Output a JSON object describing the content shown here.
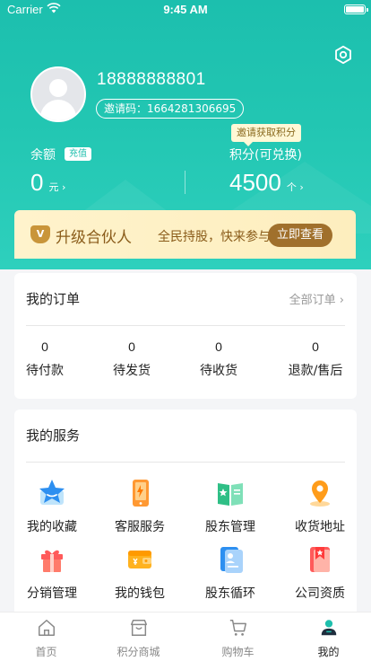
{
  "status_bar": {
    "carrier": "Carrier",
    "time": "9:45 AM"
  },
  "profile": {
    "phone": "18888888801",
    "invite_code_label": "邀请码：1664281306695"
  },
  "balance": {
    "label": "余额",
    "recharge_label": "充值",
    "value": "0",
    "unit": "元 ›"
  },
  "points": {
    "tag": "邀请获取积分",
    "label": "积分(可兑换)",
    "value": "4500",
    "unit": "个 ›"
  },
  "partner_banner": {
    "icon": "V",
    "title": "升级合伙人",
    "desc": "全民持股，快来参与",
    "button": "立即查看"
  },
  "orders": {
    "title": "我的订单",
    "more": "全部订单 ›",
    "items": [
      {
        "count": "0",
        "label": "待付款"
      },
      {
        "count": "0",
        "label": "待发货"
      },
      {
        "count": "0",
        "label": "待收货"
      },
      {
        "count": "0",
        "label": "退款/售后"
      }
    ]
  },
  "services": {
    "title": "我的服务",
    "items": [
      {
        "label": "我的收藏",
        "icon": "star-icon"
      },
      {
        "label": "客服服务",
        "icon": "phone-service-icon"
      },
      {
        "label": "股东管理",
        "icon": "book-icon"
      },
      {
        "label": "收货地址",
        "icon": "location-icon"
      },
      {
        "label": "分销管理",
        "icon": "gift-icon"
      },
      {
        "label": "我的钱包",
        "icon": "wallet-icon"
      },
      {
        "label": "股东循环",
        "icon": "id-card-icon"
      },
      {
        "label": "公司资质",
        "icon": "certificate-icon"
      }
    ]
  },
  "tabbar": {
    "items": [
      {
        "label": "首页",
        "icon": "home-icon"
      },
      {
        "label": "积分商城",
        "icon": "store-icon"
      },
      {
        "label": "购物车",
        "icon": "cart-icon"
      },
      {
        "label": "我的",
        "icon": "user-icon"
      }
    ],
    "active_index": 3
  },
  "colors": {
    "accent": "#22c6b2",
    "banner_button": "#a0702c"
  }
}
